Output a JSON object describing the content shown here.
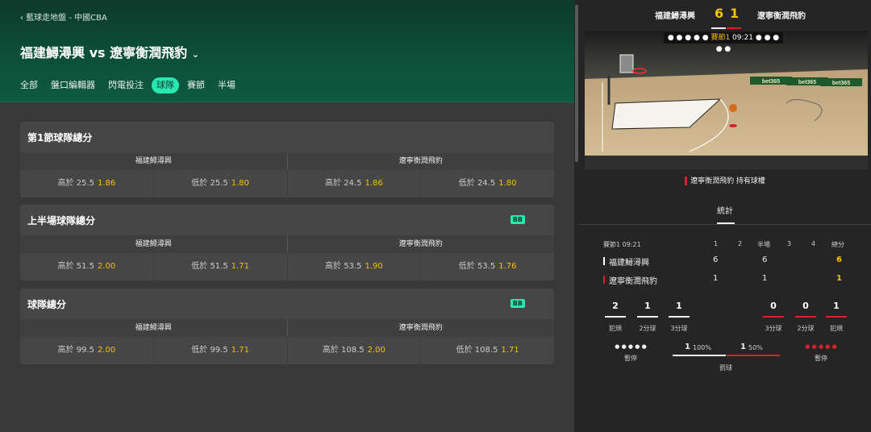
{
  "breadcrumb": "藍球走地盤 - 中國CBA",
  "match_title": "福建鱘潯興 vs 遼寧衡潤飛豹",
  "tabs": [
    "全部",
    "盤口編輯器",
    "閃電投注",
    "球隊",
    "賽節",
    "半場"
  ],
  "active_tab": "球隊",
  "teams": {
    "home": "福建鱘潯興",
    "away": "遼寧衡潤飛豹"
  },
  "markets": [
    {
      "title": "第1節球隊總分",
      "badge": "",
      "odds": [
        {
          "label": "高於 25.5",
          "price": "1.86"
        },
        {
          "label": "低於 25.5",
          "price": "1.80"
        },
        {
          "label": "高於 24.5",
          "price": "1.86"
        },
        {
          "label": "低於 24.5",
          "price": "1.80"
        }
      ]
    },
    {
      "title": "上半場球隊總分",
      "badge": "BB",
      "odds": [
        {
          "label": "高於 51.5",
          "price": "2.00"
        },
        {
          "label": "低於 51.5",
          "price": "1.71"
        },
        {
          "label": "高於 53.5",
          "price": "1.90"
        },
        {
          "label": "低於 53.5",
          "price": "1.76"
        }
      ]
    },
    {
      "title": "球隊總分",
      "badge": "BB",
      "odds": [
        {
          "label": "高於 99.5",
          "price": "2.00"
        },
        {
          "label": "低於 99.5",
          "price": "1.71"
        },
        {
          "label": "高於 108.5",
          "price": "2.00"
        },
        {
          "label": "低於 108.5",
          "price": "1.71"
        }
      ]
    }
  ],
  "scoreboard": {
    "home_score": "6",
    "away_score": "1",
    "clock_period": "賽節1",
    "clock_time": "09:21",
    "dots": "● ● ● ● ●"
  },
  "court": {
    "ads": [
      "bet365",
      "bet365",
      "bet365"
    ]
  },
  "possession": "遼寧衡潤飛豹 持有球權",
  "stats_tab": "統計",
  "stats": {
    "period_label": "賽節1",
    "period_time": "09:21",
    "headers": [
      "1",
      "2",
      "半場",
      "3",
      "4",
      "總分"
    ],
    "home_row": [
      "6",
      "",
      "6",
      "",
      "",
      "6"
    ],
    "away_row": [
      "1",
      "",
      "1",
      "",
      "",
      "1"
    ],
    "home_counts": [
      {
        "value": "2",
        "label": "犯規"
      },
      {
        "value": "1",
        "label": "2分球"
      },
      {
        "value": "1",
        "label": "3分球"
      }
    ],
    "away_counts": [
      {
        "value": "0",
        "label": "3分球"
      },
      {
        "value": "0",
        "label": "2分球"
      },
      {
        "value": "1",
        "label": "犯規"
      }
    ],
    "timeout_label": "暫停",
    "home_timeouts": "● ● ● ● ●",
    "away_timeouts": "● ● ● ● ●",
    "freethrow_label": "罰球",
    "home_ft": {
      "made": "1",
      "pct": "100%",
      "fraction": 1.0
    },
    "away_ft": {
      "made": "1",
      "pct": "50%",
      "fraction": 0.5
    }
  },
  "colors": {
    "accent": "#26e8b0",
    "price": "#f2c300",
    "home": "#ffffff",
    "away": "#d4222a"
  }
}
